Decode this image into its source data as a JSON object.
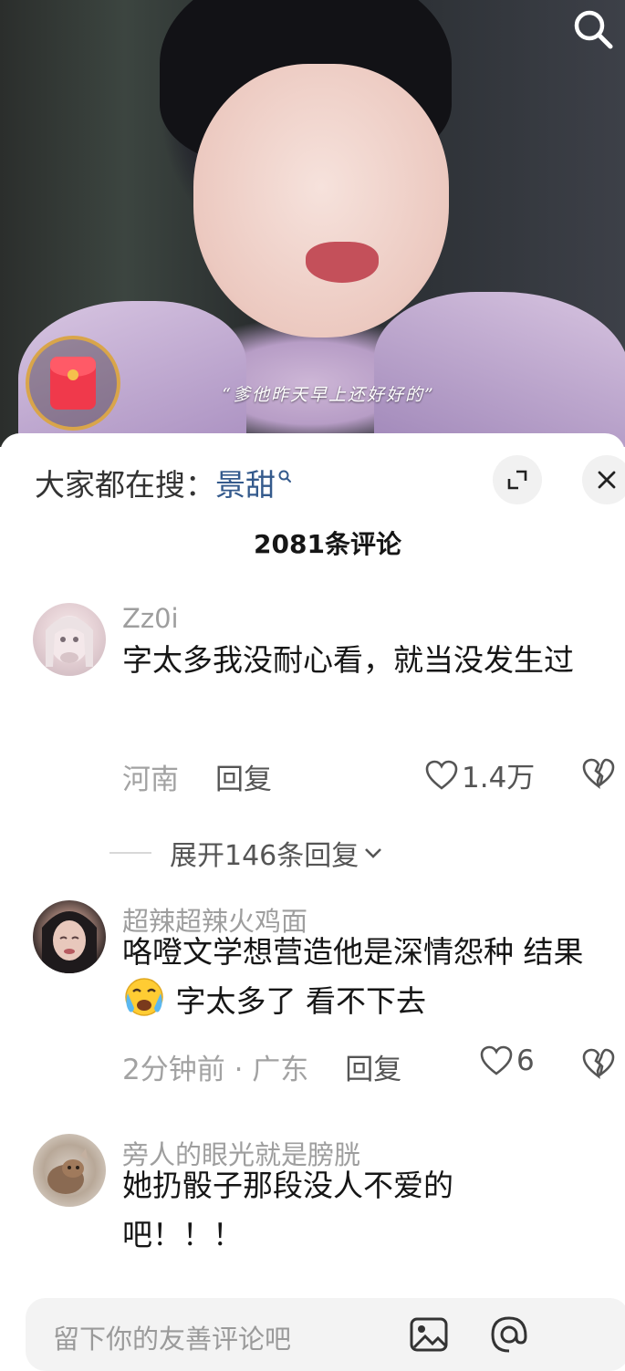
{
  "video": {
    "subtitle": "“爹他昨天早上还好好的”"
  },
  "header": {
    "hot_search_label": "大家都在搜：",
    "hot_search_keyword": "景甜",
    "comment_count_title": "2081条评论"
  },
  "comments": [
    {
      "username": "Zz0i",
      "text": "字太多我没耐心看，就当没发生过",
      "meta": "河南",
      "reply_label": "回复",
      "likes": "1.4万",
      "expand_label": "展开146条回复"
    },
    {
      "username": "超辣超辣火鸡面",
      "text_before_emoji": "咯噔文学想营造他是深情怨种 结果",
      "emoji": "crying-emoji",
      "text_after_emoji": " 字太多了 看不下去",
      "meta": "2分钟前 · 广东",
      "reply_label": "回复",
      "likes": "6"
    },
    {
      "username": "旁人的眼光就是膀胱",
      "text": "她扔骰子那段没人不爱的吧！！！"
    }
  ],
  "input": {
    "placeholder": "留下你的友善评论吧"
  },
  "colors": {
    "keyword": "#345a8c",
    "muted_text": "#9e9e9e",
    "body_text": "#161616",
    "redpacket": "#f0394b"
  }
}
